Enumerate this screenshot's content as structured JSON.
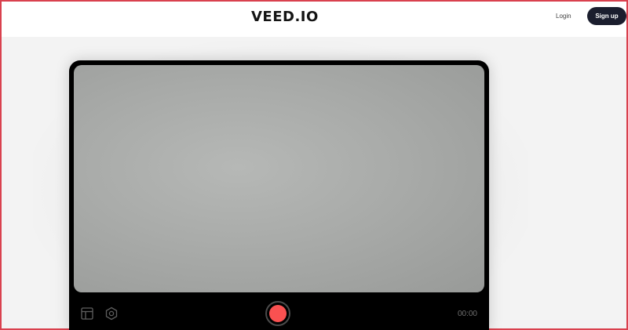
{
  "header": {
    "logo": "VEED.IO",
    "login_label": "Login",
    "signup_label": "Sign up"
  },
  "recorder": {
    "controls": {
      "layout_icon": "layout-icon",
      "settings_icon": "gear-icon",
      "record_icon": "record-icon",
      "timer": "00:00"
    }
  },
  "colors": {
    "frame_border": "#d9414e",
    "signup_bg": "#1b1e2e",
    "record": "#fa5151",
    "recorder_bg": "#000000"
  }
}
